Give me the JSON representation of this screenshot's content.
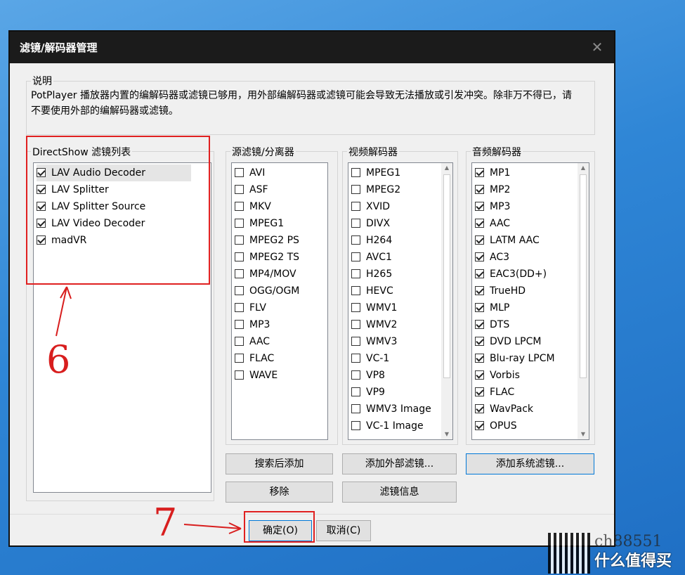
{
  "window": {
    "title": "滤镜/解码器管理",
    "close_glyph": "✕"
  },
  "description": {
    "label": "说明",
    "text": "PotPlayer 播放器内置的编解码器或滤镜已够用，用外部编解码器或滤镜可能会导致无法播放或引发冲突。除非万不得已，请不要使用外部的编解码器或滤镜。"
  },
  "directshow": {
    "label": "DirectShow 滤镜列表",
    "items": [
      {
        "label": "LAV Audio Decoder",
        "checked": true
      },
      {
        "label": "LAV Splitter",
        "checked": true
      },
      {
        "label": "LAV Splitter Source",
        "checked": true
      },
      {
        "label": "LAV Video Decoder",
        "checked": true
      },
      {
        "label": "madVR",
        "checked": true
      }
    ]
  },
  "source_filters": {
    "label": "源滤镜/分离器",
    "items": [
      {
        "label": "AVI",
        "checked": false
      },
      {
        "label": "ASF",
        "checked": false
      },
      {
        "label": "MKV",
        "checked": false
      },
      {
        "label": "MPEG1",
        "checked": false
      },
      {
        "label": "MPEG2 PS",
        "checked": false
      },
      {
        "label": "MPEG2 TS",
        "checked": false
      },
      {
        "label": "MP4/MOV",
        "checked": false
      },
      {
        "label": "OGG/OGM",
        "checked": false
      },
      {
        "label": "FLV",
        "checked": false
      },
      {
        "label": "MP3",
        "checked": false
      },
      {
        "label": "AAC",
        "checked": false
      },
      {
        "label": "FLAC",
        "checked": false
      },
      {
        "label": "WAVE",
        "checked": false
      }
    ]
  },
  "video_decoders": {
    "label": "视频解码器",
    "items": [
      {
        "label": "MPEG1",
        "checked": false
      },
      {
        "label": "MPEG2",
        "checked": false
      },
      {
        "label": "XVID",
        "checked": false
      },
      {
        "label": "DIVX",
        "checked": false
      },
      {
        "label": "H264",
        "checked": false
      },
      {
        "label": "AVC1",
        "checked": false
      },
      {
        "label": "H265",
        "checked": false
      },
      {
        "label": "HEVC",
        "checked": false
      },
      {
        "label": "WMV1",
        "checked": false
      },
      {
        "label": "WMV2",
        "checked": false
      },
      {
        "label": "WMV3",
        "checked": false
      },
      {
        "label": "VC-1",
        "checked": false
      },
      {
        "label": "VP8",
        "checked": false
      },
      {
        "label": "VP9",
        "checked": false
      },
      {
        "label": "WMV3 Image",
        "checked": false
      },
      {
        "label": "VC-1 Image",
        "checked": false
      }
    ]
  },
  "audio_decoders": {
    "label": "音频解码器",
    "items": [
      {
        "label": "MP1",
        "checked": true
      },
      {
        "label": "MP2",
        "checked": true
      },
      {
        "label": "MP3",
        "checked": true
      },
      {
        "label": "AAC",
        "checked": true
      },
      {
        "label": "LATM AAC",
        "checked": true
      },
      {
        "label": "AC3",
        "checked": true
      },
      {
        "label": "EAC3(DD+)",
        "checked": true
      },
      {
        "label": "TrueHD",
        "checked": true
      },
      {
        "label": "MLP",
        "checked": true
      },
      {
        "label": "DTS",
        "checked": true
      },
      {
        "label": "DVD LPCM",
        "checked": true
      },
      {
        "label": "Blu-ray LPCM",
        "checked": true
      },
      {
        "label": "Vorbis",
        "checked": true
      },
      {
        "label": "FLAC",
        "checked": true
      },
      {
        "label": "WavPack",
        "checked": true
      },
      {
        "label": "OPUS",
        "checked": true
      }
    ]
  },
  "buttons": {
    "search_add": "搜索后添加",
    "add_external": "添加外部滤镜...",
    "add_system": "添加系统滤镜...",
    "remove": "移除",
    "filter_info": "滤镜信息",
    "ok": "确定(O)",
    "cancel": "取消(C)"
  },
  "annotations": {
    "six": "6",
    "seven": "7",
    "accent": "#e02020"
  },
  "watermark": {
    "site": "什么值得买",
    "user": "ch88551"
  }
}
